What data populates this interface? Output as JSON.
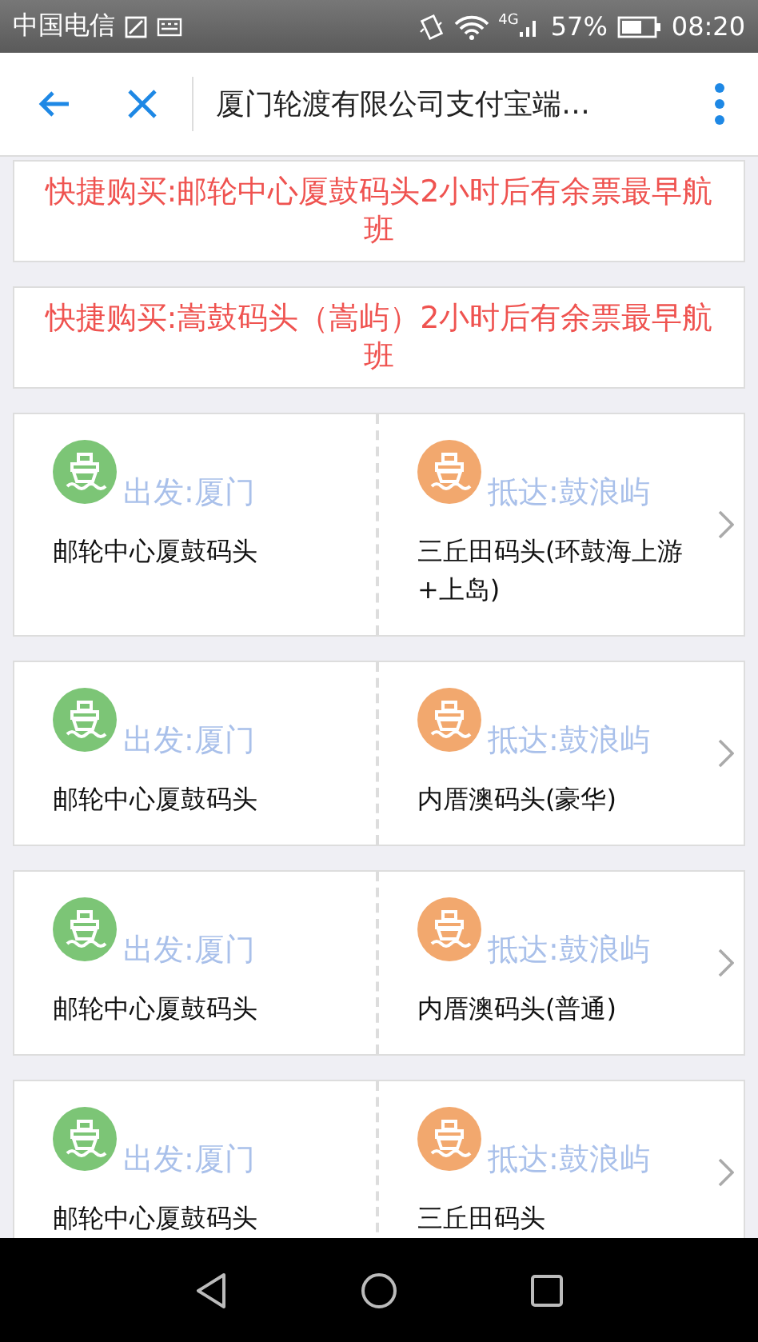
{
  "status_bar": {
    "carrier": "中国电信",
    "network": "4G",
    "battery": "57%",
    "time": "08:20"
  },
  "nav": {
    "title": "厦门轮渡有限公司支付宝端…"
  },
  "quick_buy": [
    {
      "text": "快捷购买:邮轮中心厦鼓码头2小时后有余票最早航班"
    },
    {
      "text": "快捷购买:嵩鼓码头（嵩屿）2小时后有余票最早航班"
    }
  ],
  "routes": [
    {
      "departure": {
        "label": "出发:厦门",
        "pier": "邮轮中心厦鼓码头"
      },
      "arrival": {
        "label": "抵达:鼓浪屿",
        "pier": "三丘田码头(环鼓海上游+上岛)"
      }
    },
    {
      "departure": {
        "label": "出发:厦门",
        "pier": "邮轮中心厦鼓码头"
      },
      "arrival": {
        "label": "抵达:鼓浪屿",
        "pier": "内厝澳码头(豪华)"
      }
    },
    {
      "departure": {
        "label": "出发:厦门",
        "pier": "邮轮中心厦鼓码头"
      },
      "arrival": {
        "label": "抵达:鼓浪屿",
        "pier": "内厝澳码头(普通)"
      }
    },
    {
      "departure": {
        "label": "出发:厦门",
        "pier": "邮轮中心厦鼓码头"
      },
      "arrival": {
        "label": "抵达:鼓浪屿",
        "pier": "三丘田码头"
      }
    }
  ]
}
